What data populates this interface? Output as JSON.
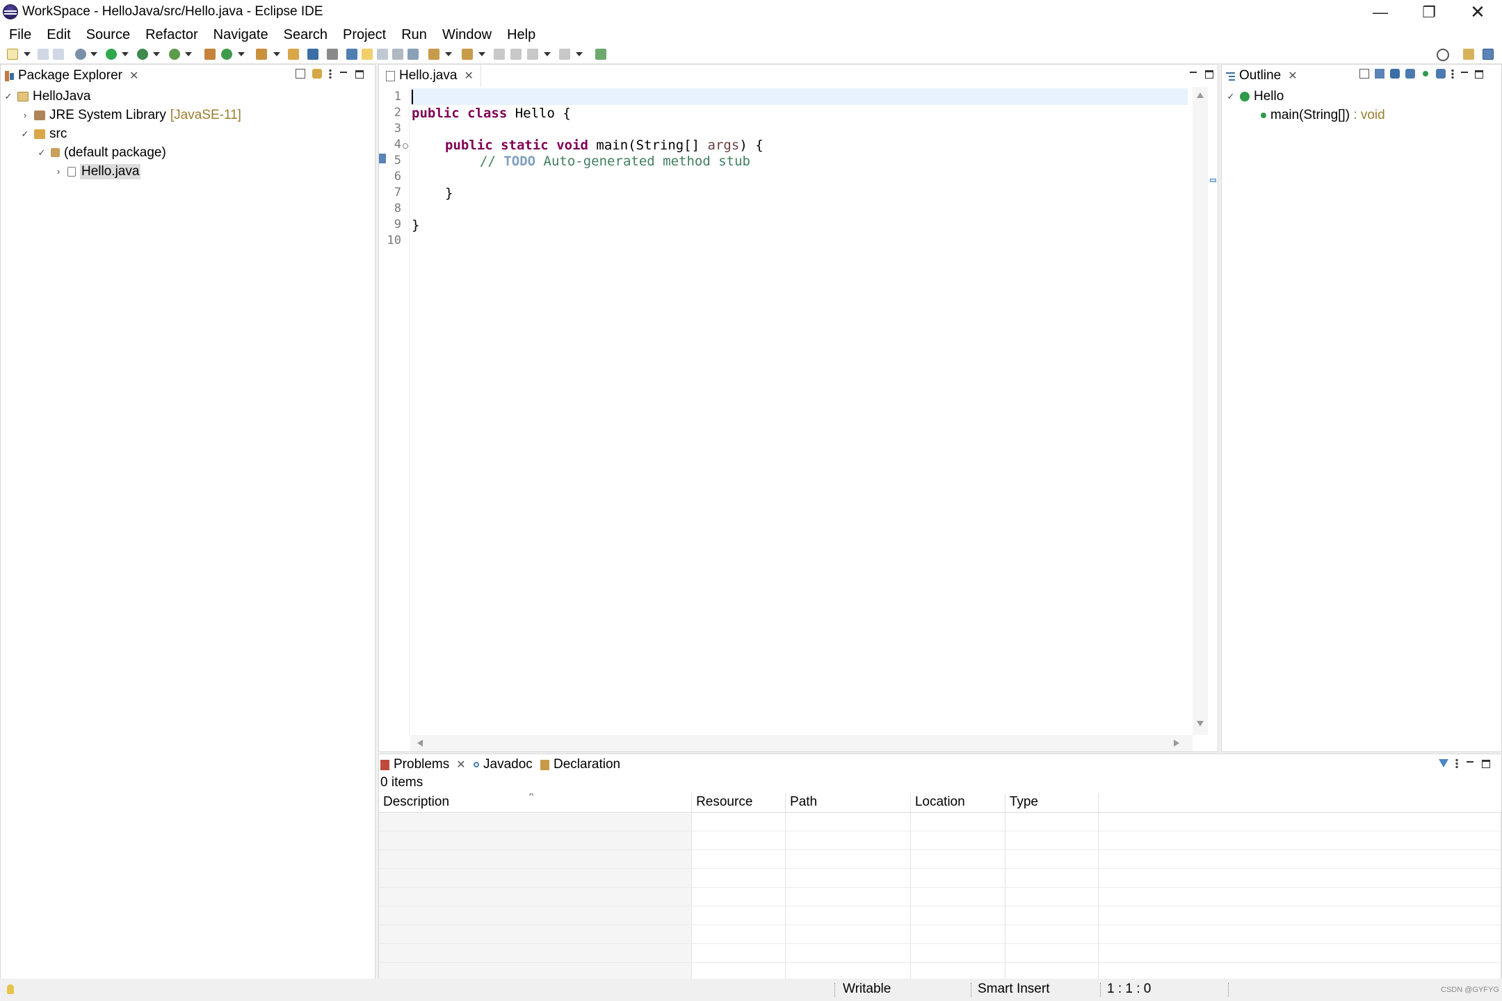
{
  "window": {
    "title": "WorkSpace - HelloJava/src/Hello.java - Eclipse IDE"
  },
  "menu": [
    "File",
    "Edit",
    "Source",
    "Refactor",
    "Navigate",
    "Search",
    "Project",
    "Run",
    "Window",
    "Help"
  ],
  "package_explorer": {
    "tab_label": "Package Explorer",
    "tree": [
      {
        "label": "HelloJava",
        "level": 0,
        "expanded": true
      },
      {
        "label": "JRE System Library",
        "decoration": "[JavaSE-11]",
        "level": 1,
        "expanded": false
      },
      {
        "label": "src",
        "level": 1,
        "expanded": true
      },
      {
        "label": "(default package)",
        "level": 2,
        "expanded": true
      },
      {
        "label": "Hello.java",
        "level": 3,
        "expanded": false,
        "selected": true
      }
    ]
  },
  "editor": {
    "tab_label": "Hello.java",
    "line_numbers": [
      "1",
      "2",
      "3",
      "4",
      "5",
      "6",
      "7",
      "8",
      "9",
      "10"
    ],
    "code": {
      "l2_kw1": "public",
      "l2_kw2": "class",
      "l2_rest": " Hello {",
      "l4_kw1": "public",
      "l4_kw2": "static",
      "l4_kw3": "void",
      "l4_mid": " main(String[] ",
      "l4_param": "args",
      "l4_end": ") {",
      "l5_comment": "//",
      "l5_todo": "TODO",
      "l5_rest": " Auto-generated method stub",
      "l7": "}",
      "l9": "}"
    }
  },
  "outline": {
    "tab_label": "Outline",
    "class_name": "Hello",
    "method": "main(String[])",
    "method_return": " : void"
  },
  "bottom": {
    "tabs": [
      "Problems",
      "Javadoc",
      "Declaration"
    ],
    "count_text": "0 items",
    "columns": [
      "Description",
      "Resource",
      "Path",
      "Location",
      "Type"
    ]
  },
  "status": {
    "writable": "Writable",
    "insert_mode": "Smart Insert",
    "position": "1 : 1 : 0",
    "watermark": "CSDN @GYFYG"
  },
  "colors": {
    "keyword": "#7f0055",
    "comment": "#3f7f5f",
    "todo": "#7f9fbf",
    "decoration": "#9a7d2c"
  }
}
